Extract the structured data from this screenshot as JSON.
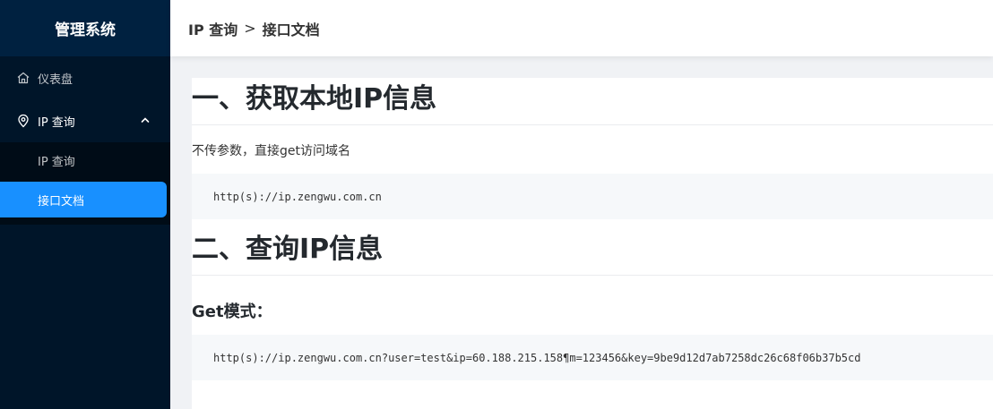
{
  "sidebar": {
    "logo": "管理系统",
    "menu": {
      "dashboard": {
        "label": "仪表盘",
        "icon": "home-icon"
      },
      "ip_query": {
        "label": "IP 查询",
        "icon": "location-pin-icon",
        "expanded": true,
        "children": [
          {
            "label": "IP 查询",
            "active": false
          },
          {
            "label": "接口文档",
            "active": true
          }
        ]
      }
    },
    "colors": {
      "background": "#001529",
      "active": "#1890ff"
    }
  },
  "header": {
    "breadcrumb": [
      "IP 查询",
      "接口文档"
    ],
    "separator": ">"
  },
  "doc": {
    "section1": {
      "title": "一、获取本地IP信息",
      "desc": "不传参数，直接get访问域名",
      "code": "http(s)://ip.zengwu.com.cn"
    },
    "section2": {
      "title": "二、查询IP信息",
      "subtitle": "Get模式：",
      "code": "http(s)://ip.zengwu.com.cn?user=test&ip=60.188.215.158¶m=123456&key=9be9d12d7ab7258dc26c68f06b37b5cd"
    }
  }
}
